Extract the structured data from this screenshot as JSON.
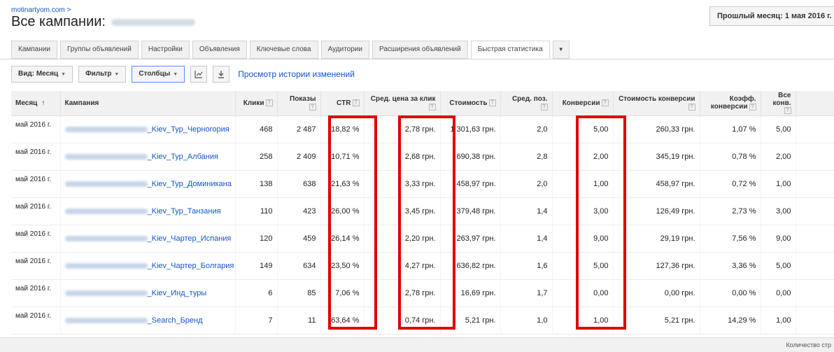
{
  "header": {
    "breadcrumb": "motinartyom.com >",
    "title": "Все кампании:",
    "date_range": "Прошлый месяц: 1 мая 2016 г. -"
  },
  "tabs": [
    {
      "label": "Кампании",
      "active": false
    },
    {
      "label": "Группы объявлений",
      "active": false
    },
    {
      "label": "Настройки",
      "active": false
    },
    {
      "label": "Объявления",
      "active": false
    },
    {
      "label": "Ключевые слова",
      "active": false
    },
    {
      "label": "Аудитории",
      "active": false
    },
    {
      "label": "Расширения объявлений",
      "active": false
    },
    {
      "label": "Быстрая статистика",
      "active": true
    }
  ],
  "toolbar": {
    "view_label": "Вид: Месяц",
    "filter_label": "Фильтр",
    "columns_label": "Столбцы",
    "history_link": "Просмотр истории изменений"
  },
  "table": {
    "headers": {
      "month": "Месяц",
      "campaign": "Кампания",
      "clicks": "Клики",
      "impressions": "Показы",
      "ctr": "CTR",
      "avg_cpc": "Сред. цена за клик",
      "cost": "Стоимость",
      "avg_pos": "Сред. поз.",
      "conversions": "Конверсии",
      "cost_per_conv": "Стоимость конверсии",
      "conv_rate": "Коэфф. конверсии",
      "all_conv": "Все конв."
    },
    "rows": [
      {
        "month": "май 2016 г.",
        "campaign": "_Kiev_Тур_Черногория",
        "clicks": "468",
        "impressions": "2 487",
        "ctr": "18,82 %",
        "avg_cpc": "2,78 грн.",
        "cost": "1 301,63 грн.",
        "avg_pos": "2,0",
        "conversions": "5,00",
        "cost_per_conv": "260,33 грн.",
        "conv_rate": "1,07 %",
        "all_conv": "5,00"
      },
      {
        "month": "май 2016 г.",
        "campaign": "_Kiev_Тур_Албания",
        "clicks": "258",
        "impressions": "2 409",
        "ctr": "10,71 %",
        "avg_cpc": "2,68 грн.",
        "cost": "690,38 грн.",
        "avg_pos": "2,8",
        "conversions": "2,00",
        "cost_per_conv": "345,19 грн.",
        "conv_rate": "0,78 %",
        "all_conv": "2,00"
      },
      {
        "month": "май 2016 г.",
        "campaign": "_Kiev_Тур_Доминикана",
        "clicks": "138",
        "impressions": "638",
        "ctr": "21,63 %",
        "avg_cpc": "3,33 грн.",
        "cost": "458,97 грн.",
        "avg_pos": "2,0",
        "conversions": "1,00",
        "cost_per_conv": "458,97 грн.",
        "conv_rate": "0,72 %",
        "all_conv": "1,00"
      },
      {
        "month": "май 2016 г.",
        "campaign": "_Kiev_Тур_Танзания",
        "clicks": "110",
        "impressions": "423",
        "ctr": "26,00 %",
        "avg_cpc": "3,45 грн.",
        "cost": "379,48 грн.",
        "avg_pos": "1,4",
        "conversions": "3,00",
        "cost_per_conv": "126,49 грн.",
        "conv_rate": "2,73 %",
        "all_conv": "3,00"
      },
      {
        "month": "май 2016 г.",
        "campaign": "_Kiev_Чартер_Испания",
        "clicks": "120",
        "impressions": "459",
        "ctr": "26,14 %",
        "avg_cpc": "2,20 грн.",
        "cost": "263,97 грн.",
        "avg_pos": "1,4",
        "conversions": "9,00",
        "cost_per_conv": "29,19 грн.",
        "conv_rate": "7,56 %",
        "all_conv": "9,00"
      },
      {
        "month": "май 2016 г.",
        "campaign": "_Kiev_Чартер_Болгария",
        "clicks": "149",
        "impressions": "634",
        "ctr": "23,50 %",
        "avg_cpc": "4,27 грн.",
        "cost": "636,82 грн.",
        "avg_pos": "1,6",
        "conversions": "5,00",
        "cost_per_conv": "127,36 грн.",
        "conv_rate": "3,36 %",
        "all_conv": "5,00"
      },
      {
        "month": "май 2016 г.",
        "campaign": "_Kiev_Инд_туры",
        "clicks": "6",
        "impressions": "85",
        "ctr": "7,06 %",
        "avg_cpc": "2,78 грн.",
        "cost": "16,69 грн.",
        "avg_pos": "1,7",
        "conversions": "0,00",
        "cost_per_conv": "0,00 грн.",
        "conv_rate": "0,00 %",
        "all_conv": "0,00"
      },
      {
        "month": "май 2016 г.",
        "campaign": "_Search_Бренд",
        "clicks": "7",
        "impressions": "11",
        "ctr": "63,64 %",
        "avg_cpc": "0,74 грн.",
        "cost": "5,21 грн.",
        "avg_pos": "1,0",
        "conversions": "1,00",
        "cost_per_conv": "5,21 грн.",
        "conv_rate": "14,29 %",
        "all_conv": "1,00"
      }
    ]
  },
  "footer": {
    "text": "Количество стр"
  },
  "highlight_color": "#e00000"
}
